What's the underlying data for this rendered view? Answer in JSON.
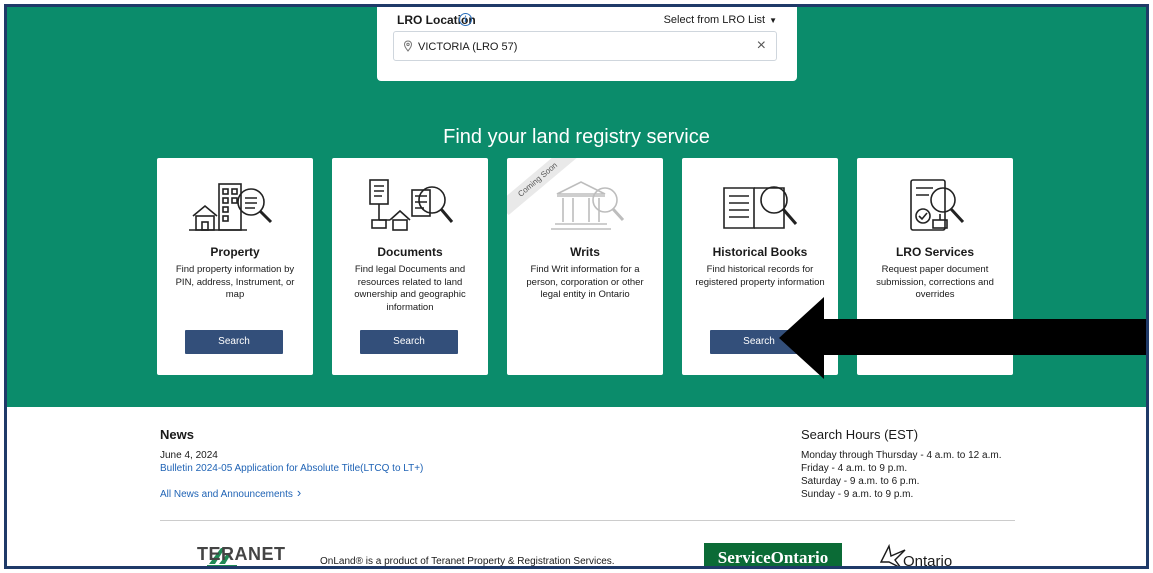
{
  "lro": {
    "label": "LRO Location",
    "select_label": "Select from LRO List",
    "value": "VICTORIA (LRO 57)"
  },
  "hero": {
    "title": "Find your land registry service"
  },
  "cards": [
    {
      "title": "Property",
      "desc": "Find property information by PIN, address, Instrument, or map",
      "button": "Search"
    },
    {
      "title": "Documents",
      "desc": "Find legal Documents and resources related to land ownership and geographic information",
      "button": "Search"
    },
    {
      "title": "Writs",
      "desc": "Find Writ information for a person, corporation or other legal entity in Ontario",
      "ribbon": "Coming Soon"
    },
    {
      "title": "Historical Books",
      "desc": "Find historical records for registered property information",
      "button": "Search"
    },
    {
      "title": "LRO Services",
      "desc": "Request paper document submission, corrections and overrides"
    }
  ],
  "news": {
    "heading": "News",
    "date": "June 4, 2024",
    "link": "Bulletin 2024-05 Application for Absolute Title(LTCQ to LT+)",
    "all": "All News and Announcements"
  },
  "hours": {
    "heading": "Search Hours (EST)",
    "lines": [
      "Monday through Thursday - 4 a.m. to 12 a.m.",
      "Friday - 4 a.m. to 9 p.m.",
      "Saturday - 9 a.m. to 6 p.m.",
      "Sunday - 9 a.m. to 9 p.m."
    ]
  },
  "footer": {
    "teranet": "TERANET",
    "onland": "OnLand® is a product of Teranet Property & Registration Services.",
    "service_ontario": "ServiceOntario",
    "ontario": "Ontario"
  },
  "colors": {
    "hero": "#0b8c6b",
    "button": "#334f7a",
    "link": "#1f63b5",
    "service_ontario": "#0b6b36"
  }
}
